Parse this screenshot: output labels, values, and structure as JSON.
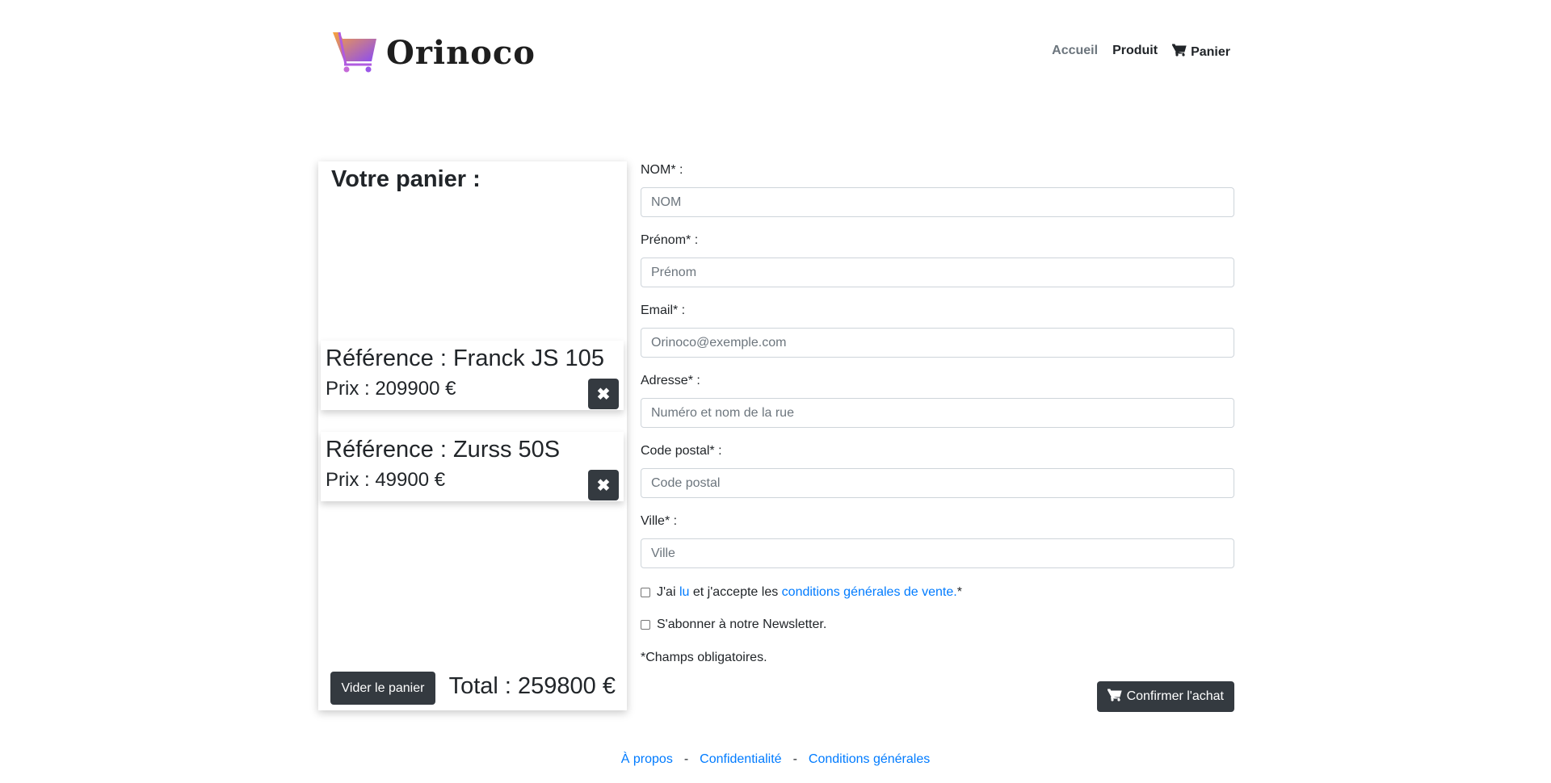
{
  "header": {
    "brand": "Orinoco",
    "nav": {
      "home": "Accueil",
      "product": "Produit",
      "cart": "Panier"
    }
  },
  "cart": {
    "title": "Votre panier :",
    "items": [
      {
        "reference": "Référence : Franck JS 105",
        "price": "Prix : 209900 €"
      },
      {
        "reference": "Référence : Zurss 50S",
        "price": "Prix : 49900 €"
      }
    ],
    "empty_label": "Vider le panier",
    "total": "Total : 259800 €"
  },
  "form": {
    "nom": {
      "label": "NOM* :",
      "placeholder": "NOM"
    },
    "prenom": {
      "label": "Prénom* :",
      "placeholder": "Prénom"
    },
    "email": {
      "label": "Email* :",
      "placeholder": "Orinoco@exemple.com"
    },
    "adresse": {
      "label": "Adresse* :",
      "placeholder": "Numéro et nom de la rue"
    },
    "code_postal": {
      "label": "Code postal* :",
      "placeholder": "Code postal"
    },
    "ville": {
      "label": "Ville* :",
      "placeholder": "Ville"
    },
    "terms": {
      "prefix": "J'ai",
      "link_read": "lu",
      "middle": "et j'accepte les",
      "link_conditions": "conditions générales de vente.",
      "suffix": "*"
    },
    "newsletter": "S'abonner à notre Newsletter.",
    "required_note": "*Champs obligatoires.",
    "confirm_label": "Confirmer l'achat"
  },
  "footer": {
    "about": "À propos",
    "privacy": "Confidentialité",
    "terms": "Conditions générales",
    "separator": "-"
  },
  "colors": {
    "dark_button": "#343a40",
    "link": "#007bff",
    "muted_nav": "#6c757d",
    "logo_gradient_start": "#f7a23b",
    "logo_gradient_end": "#8a4bf5"
  }
}
